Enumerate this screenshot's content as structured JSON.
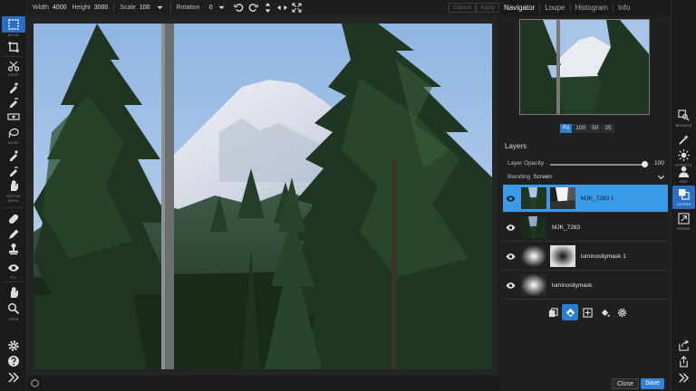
{
  "toolbar": {
    "width_label": "Width",
    "width_value": "4000",
    "height_label": "Height",
    "height_value": "3000",
    "scale_label": "Scale",
    "scale_value": "100",
    "rotation_label": "Rotation",
    "rotation_value": "0",
    "cancel_label": "Cancel",
    "apply_label": "Apply"
  },
  "left_tools": {
    "move_label": "MOVE",
    "crop_label": "CROP",
    "mask_label": "MASK",
    "refine_label": "REFINE",
    "refine_label2": "MASK",
    "fix_label": "FIX",
    "view_label": "VIEW"
  },
  "panel": {
    "tabs": [
      {
        "label": "Navigator"
      },
      {
        "label": "Loupe"
      },
      {
        "label": "Histogram"
      },
      {
        "label": "Info"
      }
    ],
    "zoom": [
      {
        "label": "Fit"
      },
      {
        "label": "100"
      },
      {
        "label": "50"
      },
      {
        "label": "25"
      }
    ],
    "layers_title": "Layers",
    "opacity_label": "Layer Opacity",
    "opacity_value": "100",
    "opacity_fraction": 1.0,
    "blend_label": "Blending",
    "blend_value": "Screen",
    "layers": [
      {
        "name": "MJK_7283 1"
      },
      {
        "name": "MJK_7283"
      },
      {
        "name": "luminositymask 1"
      },
      {
        "name": "luminositymask"
      }
    ],
    "close_label": "Close",
    "save_label": "Save"
  },
  "modules": {
    "browse": "BROWSE",
    "effects": "EFFECTS",
    "edit": "EDIT",
    "layers": "LAYERS",
    "resize": "RESIZE"
  },
  "colors": {
    "accent": "#2f86d6",
    "selected_layer": "#3a9ae8"
  }
}
